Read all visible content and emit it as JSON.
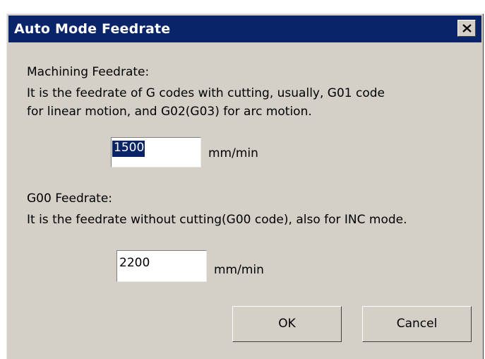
{
  "dialog": {
    "title": "Auto Mode Feedrate",
    "close_icon": "close-icon"
  },
  "machining": {
    "heading": "Machining Feedrate:",
    "description_line1": "It is the feedrate of G codes with cutting, usually, G01 code",
    "description_line2": "for linear motion, and G02(G03) for arc motion.",
    "value": "1500",
    "unit": "mm/min"
  },
  "g00": {
    "heading": "G00 Feedrate:",
    "description": "It is the feedrate without cutting(G00 code), also for INC mode.",
    "value": "2200",
    "unit": "mm/min"
  },
  "buttons": {
    "ok_label": "OK",
    "cancel_label": "Cancel"
  },
  "colors": {
    "titlebar": "#0a246a",
    "dialog_bg": "#d4d0c8",
    "selection": "#0a246a"
  }
}
